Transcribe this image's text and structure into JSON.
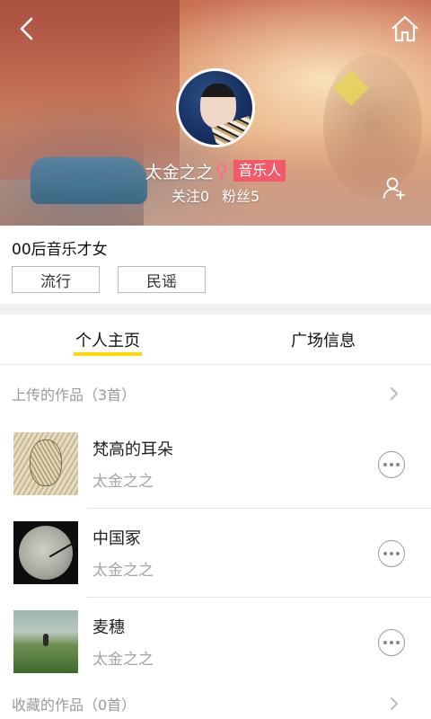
{
  "header": {
    "back_icon": "back-chevron-icon",
    "home_icon": "home-icon",
    "follow_icon": "add-user-icon"
  },
  "profile": {
    "name": "太金之之",
    "gender_symbol": "♀",
    "role_badge": "音乐人",
    "following": "关注0",
    "fans": "粉丝5",
    "bio": "00后音乐才女",
    "tags": [
      "流行",
      "民谣"
    ]
  },
  "tabs": [
    {
      "label": "个人主页",
      "active": true
    },
    {
      "label": "广场信息",
      "active": false
    }
  ],
  "uploads": {
    "label": "上传的作品（3首）"
  },
  "songs": [
    {
      "title": "梵高的耳朵",
      "artist": "太金之之"
    },
    {
      "title": "中国冢",
      "artist": "太金之之"
    },
    {
      "title": "麦穗",
      "artist": "太金之之"
    }
  ],
  "favorites": {
    "label": "收藏的作品（0首）"
  },
  "colors": {
    "accent_yellow": "#ffd800",
    "badge_red": "#f25a6a",
    "gender_pink": "#ff6b8b"
  }
}
